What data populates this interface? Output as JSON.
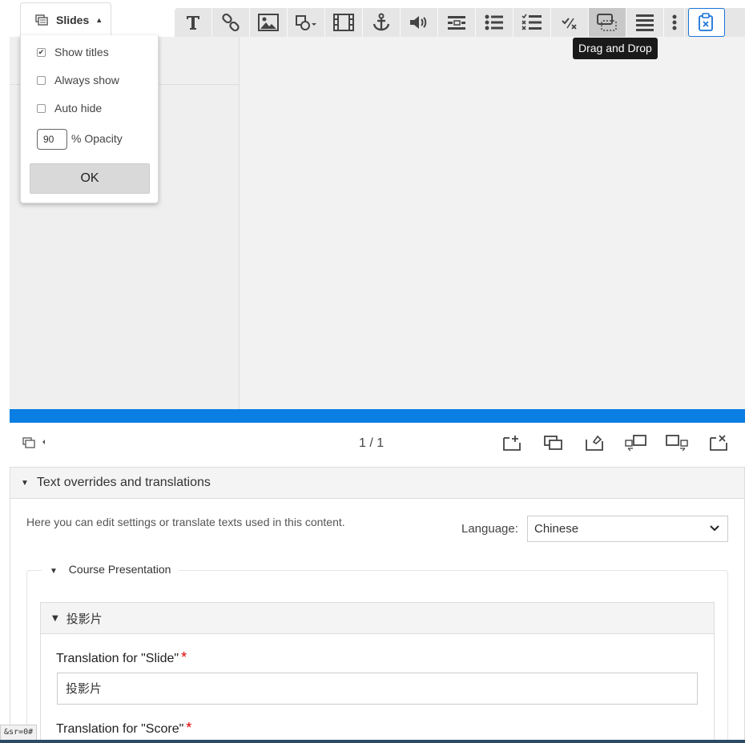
{
  "slides_menu": {
    "tab_label": "Slides",
    "options": [
      {
        "label": "Show titles",
        "checked": true
      },
      {
        "label": "Always show",
        "checked": false
      },
      {
        "label": "Auto hide",
        "checked": false
      }
    ],
    "opacity_value": "90",
    "opacity_label": "% Opacity",
    "ok_label": "OK"
  },
  "toolbar": {
    "tooltip": "Drag and Drop",
    "buttons": [
      "text-icon",
      "link-icon",
      "image-icon",
      "shapes-icon",
      "video-icon",
      "anchor-icon",
      "audio-icon",
      "fill-blanks-icon",
      "single-choice-icon",
      "multi-choice-icon",
      "true-false-icon",
      "drag-drop-icon",
      "summary-icon",
      "more-icon",
      "clipboard-icon"
    ]
  },
  "navigation": {
    "page_indicator": "1 / 1"
  },
  "overrides": {
    "title": "Text overrides and translations",
    "description": "Here you can edit settings or translate texts used in this content.",
    "language_label": "Language:",
    "language_value": "Chinese",
    "course_presentation_label": "Course Presentation",
    "slide_group_label": "投影片",
    "slide_field_label": "Translation for \"Slide\"",
    "slide_field_value": "投影片",
    "score_field_label": "Translation for \"Score\"",
    "required_mark": "*"
  },
  "status": {
    "url_fragment": "&sr=0#"
  },
  "colors": {
    "accent_blue": "#0a7ee2",
    "required_red": "#dd0000",
    "tooltip_bg": "#1a1a1a"
  }
}
